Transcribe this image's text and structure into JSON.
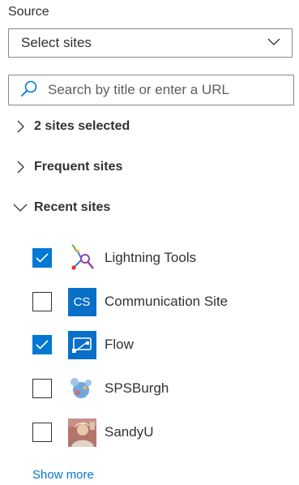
{
  "source": {
    "label": "Source",
    "dropdown_value": "Select sites"
  },
  "search": {
    "placeholder": "Search by title or enter a URL",
    "value": ""
  },
  "sections": {
    "selected": {
      "label": "2 sites selected",
      "expanded": false
    },
    "frequent": {
      "label": "Frequent sites",
      "expanded": false
    },
    "recent": {
      "label": "Recent sites",
      "expanded": true
    }
  },
  "recent_sites": [
    {
      "name": "Lightning Tools",
      "checked": true,
      "icon": "lightning-tools-logo-icon"
    },
    {
      "name": "Communication Site",
      "checked": false,
      "icon": "communication-site-icon",
      "tile_text": "CS",
      "tile_color": "#0a6fc7"
    },
    {
      "name": "Flow",
      "checked": true,
      "icon": "flow-icon"
    },
    {
      "name": "SPSBurgh",
      "checked": false,
      "icon": "spsburgh-logo-icon"
    },
    {
      "name": "SandyU",
      "checked": false,
      "icon": "sandyu-avatar-icon"
    }
  ],
  "show_more": "Show more",
  "colors": {
    "accent": "#0078d4",
    "text": "#323130",
    "border": "#8a8886"
  }
}
